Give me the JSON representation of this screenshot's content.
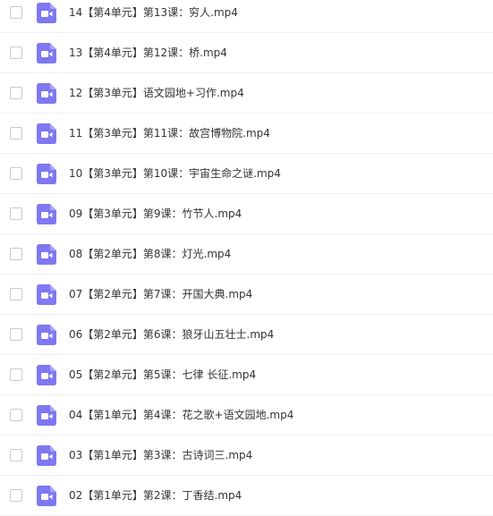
{
  "theme": {
    "icon_color": "#7f78f0",
    "icon_glyph_color": "#ffffff",
    "text_color": "#333333"
  },
  "files": [
    {
      "name": "14【第4单元】第13课：穷人.mp4",
      "icon": "video-file-icon"
    },
    {
      "name": "13【第4单元】第12课：桥.mp4",
      "icon": "video-file-icon"
    },
    {
      "name": "12【第3单元】语文园地+习作.mp4",
      "icon": "video-file-icon"
    },
    {
      "name": "11【第3单元】第11课：故宫博物院.mp4",
      "icon": "video-file-icon"
    },
    {
      "name": "10【第3单元】第10课：宇宙生命之谜.mp4",
      "icon": "video-file-icon"
    },
    {
      "name": "09【第3单元】第9课：竹节人.mp4",
      "icon": "video-file-icon"
    },
    {
      "name": "08【第2单元】第8课：灯光.mp4",
      "icon": "video-file-icon"
    },
    {
      "name": "07【第2单元】第7课：开国大典.mp4",
      "icon": "video-file-icon"
    },
    {
      "name": "06【第2单元】第6课：狼牙山五壮士.mp4",
      "icon": "video-file-icon"
    },
    {
      "name": "05【第2单元】第5课：七律 长征.mp4",
      "icon": "video-file-icon"
    },
    {
      "name": "04【第1单元】第4课：花之歌+语文园地.mp4",
      "icon": "video-file-icon"
    },
    {
      "name": "03【第1单元】第3课：古诗词三.mp4",
      "icon": "video-file-icon"
    },
    {
      "name": "02【第1单元】第2课：丁香结.mp4",
      "icon": "video-file-icon"
    }
  ]
}
